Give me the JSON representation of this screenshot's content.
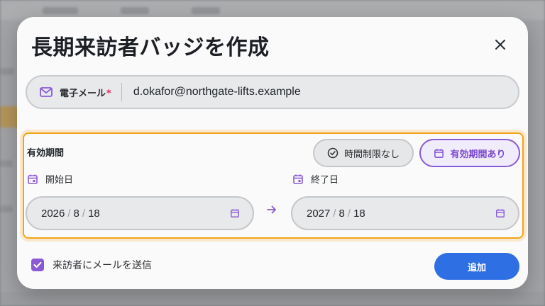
{
  "dialog": {
    "title": "長期来訪者バッジを作成",
    "close_symbol": "×"
  },
  "email": {
    "label": "電子メール",
    "required_mark": "*",
    "value": "d.okafor@northgate-lifts.example",
    "icon": "mail-icon"
  },
  "validity": {
    "label": "有効期間",
    "options": [
      {
        "label": "時間制限なし",
        "icon": "check-circle-icon",
        "selected": false
      },
      {
        "label": "有効期間あり",
        "icon": "calendar-icon",
        "selected": true
      }
    ],
    "start": {
      "label": "開始日",
      "year": "2026",
      "month": "8",
      "day": "18"
    },
    "end": {
      "label": "終了日",
      "year": "2027",
      "month": "8",
      "day": "18"
    }
  },
  "notify": {
    "label": "来訪者にメールを送信",
    "checked": true
  },
  "actions": {
    "add_label": "追加"
  },
  "colors": {
    "accent": "#8a5ad6",
    "primary": "#2f6fe4",
    "highlight": "#f2a31a"
  }
}
